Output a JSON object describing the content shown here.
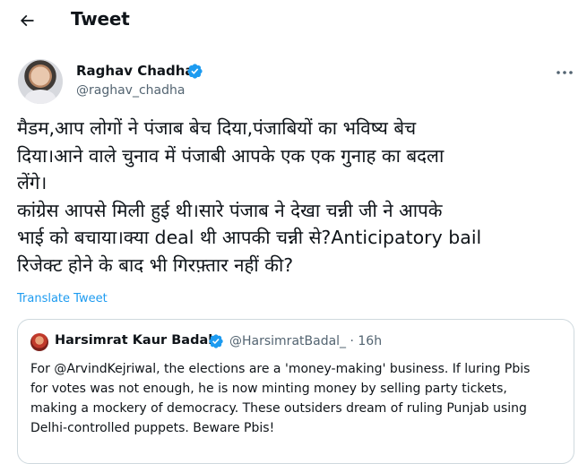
{
  "header": {
    "title": "Tweet"
  },
  "tweet": {
    "author_name": "Raghav Chadha",
    "handle": "@raghav_chadha",
    "text": "मैडम,आप लोगों ने पंजाब बेच दिया,पंजाबियों का भविष्य बेच\nदिया।आने वाले चुनाव में पंजाबी आपके एक एक गुनाह का बदला\nलेंगे।\nकांग्रेस आपसे मिली हुई थी।सारे पंजाब ने देखा चन्नी जी ने आपके\nभाई को बचाया।क्या deal थी आपकी चन्नी से?Anticipatory bail\nरिजेक्ट होने के बाद भी गिरफ़्तार नहीं की?",
    "translate_label": "Translate Tweet"
  },
  "quote": {
    "author_name": "Harsimrat Kaur Badal",
    "handle_time": "@HarsimratBadal_ · 16h",
    "text": "For @ArvindKejriwal, the elections are a 'money-making' business. If luring Pbis\nfor votes was not enough, he is now minting money by selling party tickets,\nmaking a mockery of democracy. These outsiders dream of ruling Punjab using\nDelhi-controlled puppets. Beware Pbis!"
  },
  "colors": {
    "accent": "#1d9bf0",
    "secondary_text": "#536471",
    "border": "#cfd9de"
  },
  "icons": [
    "back-arrow-icon",
    "verified-badge-icon",
    "more-icon"
  ]
}
